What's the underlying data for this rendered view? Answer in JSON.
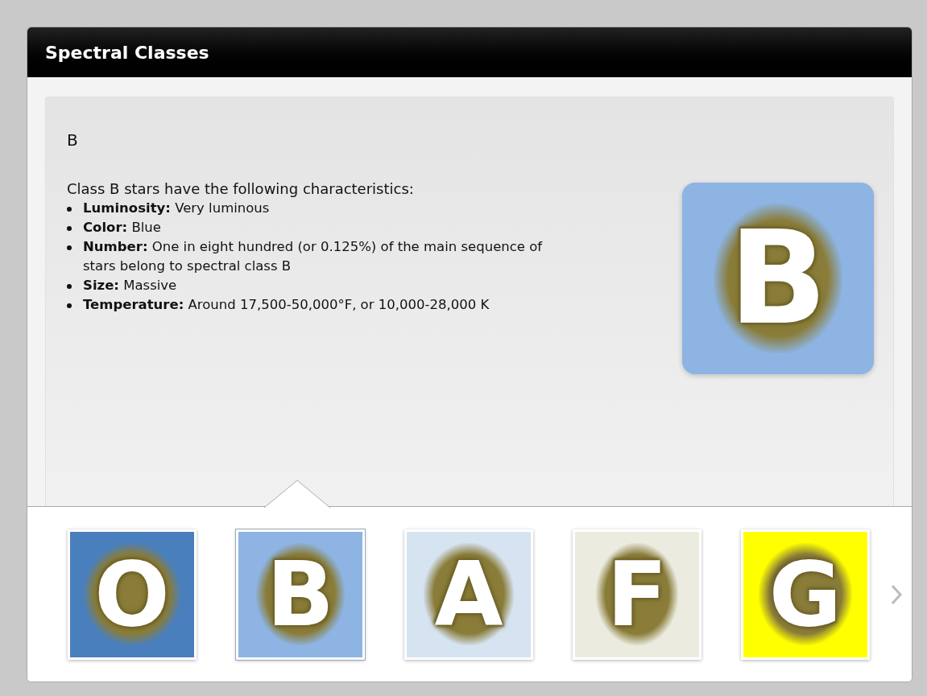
{
  "window": {
    "title": "Spectral Classes"
  },
  "detail": {
    "heading": "B",
    "intro": "Class B stars have the following characteristics:",
    "tile": {
      "letter": "B",
      "color": "#8db4e2"
    },
    "bullets": [
      "**Luminosity:** Very luminous",
      "**Color:** Blue",
      "**Number:** One in eight hundred (or 0.125%) of the main sequence of stars belong to spectral class B",
      "**Size:** Massive",
      "**Temperature:** Around 17,500-50,000°F, or 10,000-28,000 K"
    ]
  },
  "classes": [
    {
      "letter": "O",
      "color": "#4a7fbd",
      "selected": false
    },
    {
      "letter": "B",
      "color": "#8db4e2",
      "selected": true
    },
    {
      "letter": "A",
      "color": "#d6e3f1",
      "selected": false
    },
    {
      "letter": "F",
      "color": "#ebebe0",
      "selected": false
    },
    {
      "letter": "G",
      "color": "#ffff00",
      "selected": false
    }
  ]
}
